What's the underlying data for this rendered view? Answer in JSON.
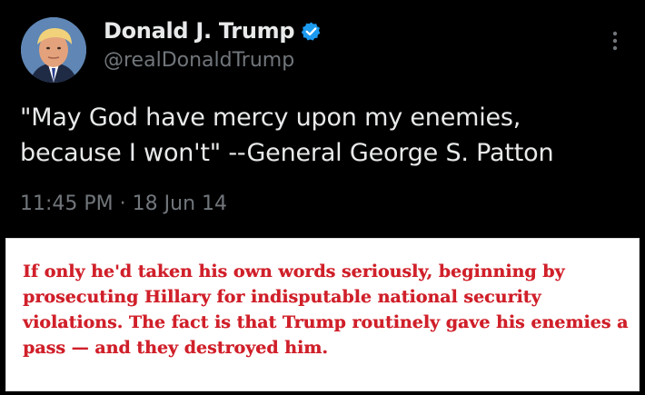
{
  "tweet": {
    "author_name": "Donald J. Trump",
    "handle": "@realDonaldTrump",
    "verified_icon": "verified-check-icon",
    "more_icon": "more-vertical-icon",
    "text": "\"May God have mercy upon my enemies,\nbecause I won't\" --General George S. Patton",
    "time": "11:45 PM",
    "separator": "·",
    "date": "18 Jun 14"
  },
  "note": {
    "text": "If only he'd taken his own words seriously, beginning by prosecuting Hillary for indisputable national security violations. The fact is that Trump routinely gave his enemies a pass — and they destroyed him."
  },
  "colors": {
    "background": "#000000",
    "primary_text": "#e7e9ea",
    "secondary_text": "#71767b",
    "verified": "#1d9bf0",
    "note_text": "#d0202a",
    "note_background": "#ffffff"
  }
}
